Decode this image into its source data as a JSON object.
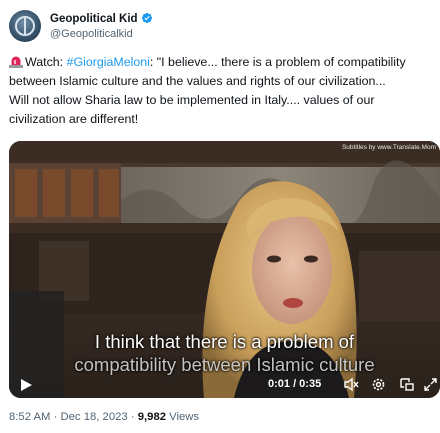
{
  "author": {
    "display_name": "Geopolitical Kid",
    "handle": "@Geopoliticalkid"
  },
  "tweet": {
    "line1_prefix": "Watch: ",
    "line1_hashtag": "#GiorgiaMeloni",
    "line1_suffix": ": \"I believe... there is a problem of compatibility",
    "line2": "between Islamic culture and the values and rights of our civilization...",
    "line3": "Will not allow Sharia law to be implemented in Italy.... values of our",
    "line4": "civilization are different!"
  },
  "video": {
    "subtitle_credit": "Subtitles by www.Translate.Mom",
    "caption_line1": "I think that there is a problem of",
    "caption_line2": "compatibility between Islamic culture",
    "time": "0:01 / 0:35"
  },
  "meta": {
    "timestamp": "8:52 AM · Dec 18, 2023 · ",
    "views_count": "9,982",
    "views_label": " Views"
  },
  "colors": {
    "accent": "#1d9bf0",
    "text": "#0f1419",
    "secondary": "#536471"
  },
  "icons": [
    "globe-avatar",
    "verified-badge-icon",
    "siren-icon",
    "play-icon",
    "volume-icon",
    "settings-icon",
    "pip-icon",
    "fullscreen-icon"
  ]
}
